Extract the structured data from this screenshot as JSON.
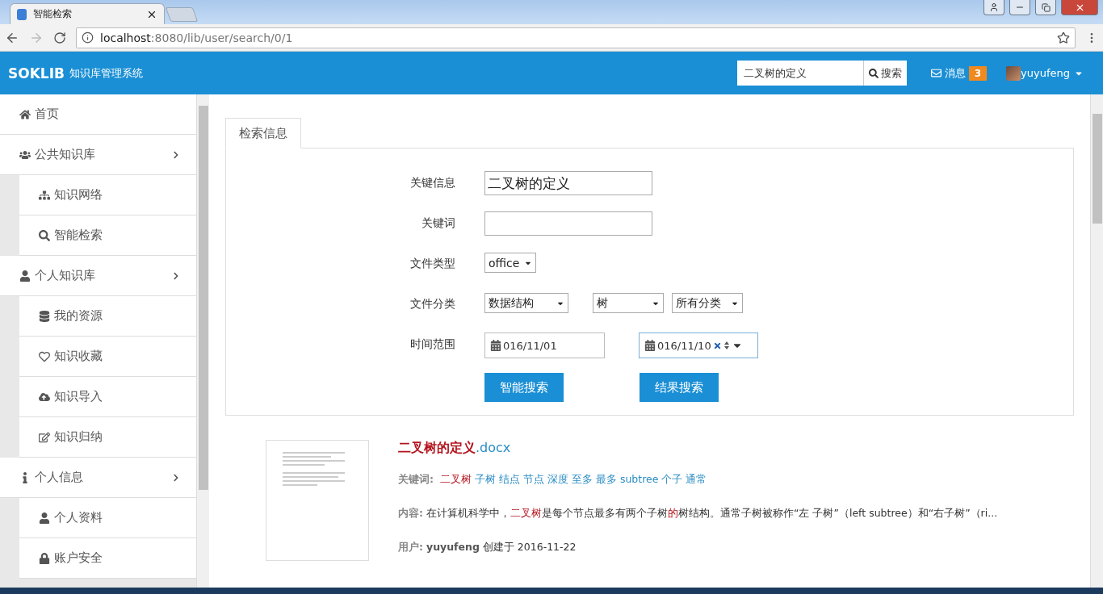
{
  "browser": {
    "tab_title": "智能检索",
    "url_host": "localhost",
    "url_path": ":8080/lib/user/search/0/1"
  },
  "header": {
    "brand": "SOKLIB",
    "subtitle": "知识库管理系统",
    "search_value": "二叉树的定义",
    "search_button": "搜索",
    "messages_label": "消息",
    "messages_count": "3",
    "user": "yuyufeng"
  },
  "sidebar": {
    "items": [
      {
        "label": "首页"
      },
      {
        "label": "公共知识库",
        "expanded": true,
        "children": [
          {
            "label": "知识网络"
          },
          {
            "label": "智能检索"
          }
        ]
      },
      {
        "label": "个人知识库",
        "expanded": true,
        "children": [
          {
            "label": "我的资源"
          },
          {
            "label": "知识收藏"
          },
          {
            "label": "知识导入"
          },
          {
            "label": "知识归纳"
          }
        ]
      },
      {
        "label": "个人信息",
        "expanded": true,
        "children": [
          {
            "label": "个人资料"
          },
          {
            "label": "账户安全"
          }
        ]
      }
    ]
  },
  "tabs": [
    {
      "label": "检索信息",
      "selected": true
    }
  ],
  "form": {
    "key_info_label": "关键信息",
    "key_info_value": "二叉树的定义",
    "keyword_label": "关键词",
    "file_type_label": "文件类型",
    "file_type_value": "office",
    "category_label": "文件分类",
    "categories": [
      "数据结构",
      "树",
      "所有分类"
    ],
    "time_label": "时间范围",
    "date_from": "016/11/01",
    "date_to": "016/11/10",
    "buttons": [
      "智能搜索",
      "结果搜索"
    ]
  },
  "results": [
    {
      "title": "二叉树的定义",
      "ext": ".docx",
      "keywords_label": "关键词:",
      "keywords": [
        {
          "text": "二叉树",
          "highlight": true
        },
        {
          "text": "子树",
          "highlight": false
        },
        {
          "text": "结点",
          "highlight": false
        },
        {
          "text": "节点",
          "highlight": false
        },
        {
          "text": "深度",
          "highlight": false
        },
        {
          "text": "至多",
          "highlight": false
        },
        {
          "text": "最多",
          "highlight": false
        },
        {
          "text": "subtree",
          "highlight": false
        },
        {
          "text": "个子",
          "highlight": false
        },
        {
          "text": "通常",
          "highlight": false
        }
      ],
      "content_label": "内容:",
      "content": [
        {
          "text": "在计算机科学中，",
          "highlight": false
        },
        {
          "text": "二叉树",
          "highlight": true
        },
        {
          "text": "是每个节点最多有两个子树",
          "highlight": false
        },
        {
          "text": "的",
          "highlight": true
        },
        {
          "text": "树结构。通常子树被称作“左 子树”（left subtree）和“右子树”（ri...",
          "highlight": false
        }
      ],
      "user_label": "用户:",
      "user": "yuyufeng",
      "created_label": "创建于",
      "created": "2016-11-22"
    }
  ]
}
